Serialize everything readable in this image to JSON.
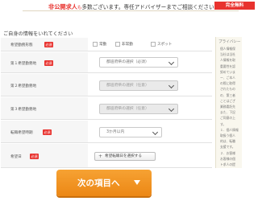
{
  "banner": {
    "text_red": "非公開求人",
    "text_small": "も",
    "text_main": "多数ございます。専任アドバイザーまでご相談ください！",
    "badge": "完全無料"
  },
  "heading": "ご自身の情報をいれてください",
  "required_label": "必須",
  "form": {
    "rows": [
      {
        "label": "希望勤務形態",
        "required": true,
        "type": "checkboxes",
        "options": [
          "常勤",
          "非常勤",
          "スポット"
        ]
      },
      {
        "label": "第１希望勤務地",
        "required": true,
        "type": "select",
        "value": "都道府県の選択（必須）",
        "disabled": false
      },
      {
        "label": "第２希望勤務地",
        "required": false,
        "type": "select",
        "value": "都道府県の選択（任意）",
        "disabled": true
      },
      {
        "label": "第３希望勤務地",
        "required": false,
        "type": "select",
        "value": "都道府県の選択（任意）",
        "disabled": true
      },
      {
        "label": "転職希望時期",
        "required": true,
        "type": "select",
        "value": "3か月以内",
        "disabled": false
      },
      {
        "label": "希望日",
        "required": true,
        "type": "button",
        "value": "希望転職日を選択する"
      }
    ]
  },
  "side": {
    "title": "プライバシー",
    "lines": [
      "個人情報保",
      "当社は当社",
      "人情報を取",
      "重要性を認",
      "努めていま",
      "ー、ご本人",
      "の際に取得",
      "されたもの",
      "の、第三者",
      "ことはござ",
      "業務委託先",
      "また、下記",
      "ご同意の上",
      "す。",
      "１．個人情報",
      "取扱う個人",
      "的は、転職",
      "支援です。",
      "２．お客様",
      "お客様の個",
      "ト求人の提"
    ]
  },
  "next_button": {
    "label": "次の項目へ"
  },
  "colors": {
    "accent_red": "#e8322e",
    "button_orange": "#f39a2c"
  }
}
